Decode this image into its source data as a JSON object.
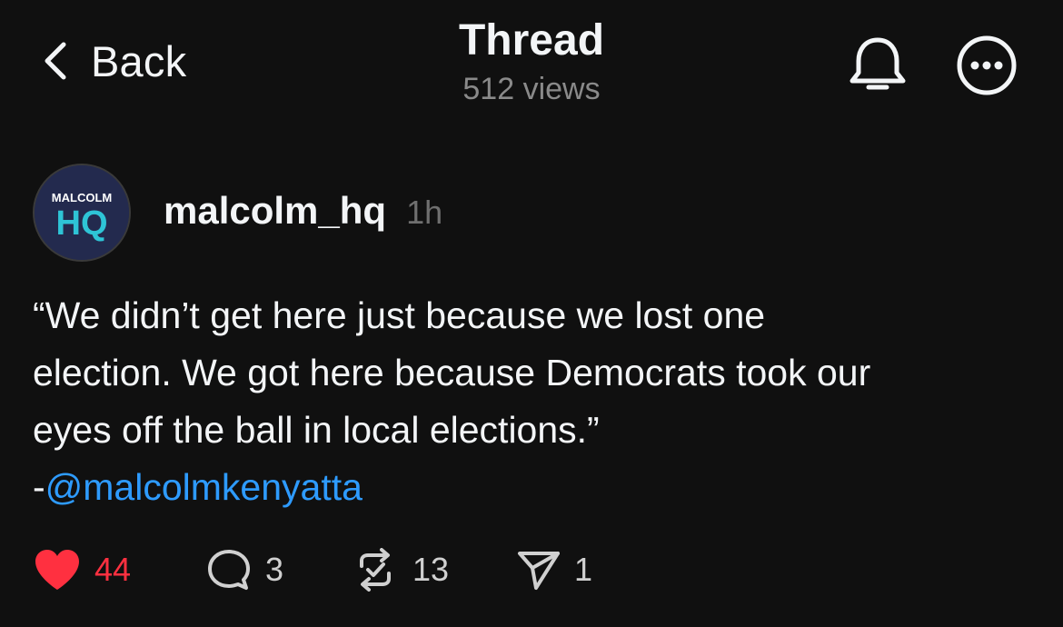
{
  "header": {
    "back_label": "Back",
    "title": "Thread",
    "views": "512 views",
    "back_icon": "chevron-left-icon",
    "notification_icon": "bell-icon",
    "more_icon": "more-circle-icon"
  },
  "post": {
    "avatar_text_top": "MALCOLM",
    "avatar_text_main": "HQ",
    "username": "malcolm_hq",
    "time": "1h",
    "text_line1": "“We didn’t get here just because we lost one",
    "text_line2": "election. We got here because Democrats took our",
    "text_line3": "eyes off the ball in local elections.”",
    "text_prefix": "-",
    "mention": "@malcolmkenyatta"
  },
  "actions": {
    "likes": "44",
    "replies": "3",
    "reposts": "13",
    "shares": "1"
  },
  "colors": {
    "background": "#101010",
    "text": "#f3f5f7",
    "muted": "#8a8a8a",
    "like": "#ff3040",
    "mention": "#2e9bff",
    "avatar_bg": "#232a4e",
    "avatar_accent": "#2ec4d6"
  }
}
